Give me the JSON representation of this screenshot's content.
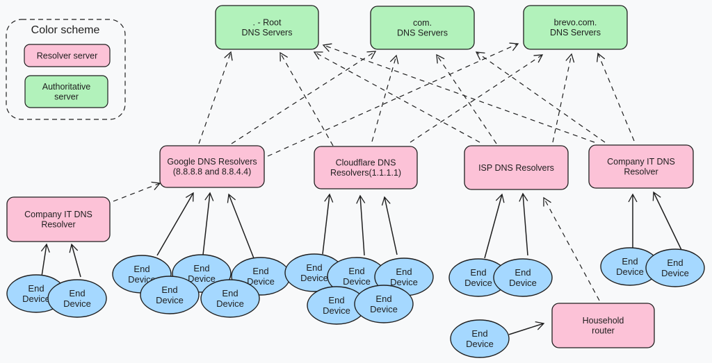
{
  "colors": {
    "background": "#f8f9fa",
    "resolver": "#fcc2d7",
    "authoritative": "#b2f2bb",
    "end_device": "#a5d8ff",
    "stroke": "#1e1e1e"
  },
  "legend": {
    "title": "Color scheme",
    "items": [
      {
        "kind": "resolver",
        "lines": [
          "Resolver server"
        ]
      },
      {
        "kind": "authoritative",
        "lines": [
          "Authoritative",
          "server"
        ]
      }
    ]
  },
  "nodes": [
    {
      "id": "root",
      "kind": "authoritative",
      "lines": [
        ". - Root",
        "DNS Servers"
      ]
    },
    {
      "id": "com",
      "kind": "authoritative",
      "lines": [
        "com.",
        "DNS Servers"
      ]
    },
    {
      "id": "brevo",
      "kind": "authoritative",
      "lines": [
        "brevo.com.",
        "DNS Servers"
      ]
    },
    {
      "id": "google",
      "kind": "resolver",
      "lines": [
        "Google DNS Resolvers",
        "(8.8.8.8 and 8.8.4.4)"
      ]
    },
    {
      "id": "cloudflare",
      "kind": "resolver",
      "lines": [
        "Cloudflare DNS",
        "Resolvers(1.1.1.1)"
      ]
    },
    {
      "id": "isp",
      "kind": "resolver",
      "lines": [
        "ISP DNS Resolvers"
      ]
    },
    {
      "id": "company-right",
      "kind": "resolver",
      "lines": [
        "Company IT DNS",
        "Resolver"
      ]
    },
    {
      "id": "company-left",
      "kind": "resolver",
      "lines": [
        "Company IT DNS",
        "Resolver"
      ]
    },
    {
      "id": "household",
      "kind": "resolver",
      "lines": [
        "Household",
        "router"
      ]
    }
  ],
  "end_device": {
    "lines": [
      "End",
      "Device"
    ]
  },
  "end_device_groups": [
    {
      "connects_to": "company-left",
      "count": 2
    },
    {
      "connects_to": "google",
      "count": 5
    },
    {
      "connects_to": "cloudflare",
      "count": 5
    },
    {
      "connects_to": "isp",
      "count": 2
    },
    {
      "connects_to": "household",
      "count": 1
    },
    {
      "connects_to": "company-right",
      "count": 2
    }
  ],
  "edges": {
    "dashed": [
      [
        "company-left",
        "google"
      ],
      [
        "household",
        "isp"
      ],
      [
        "google",
        "root"
      ],
      [
        "google",
        "com"
      ],
      [
        "google",
        "brevo"
      ],
      [
        "cloudflare",
        "root"
      ],
      [
        "cloudflare",
        "com"
      ],
      [
        "cloudflare",
        "brevo"
      ],
      [
        "isp",
        "root"
      ],
      [
        "isp",
        "com"
      ],
      [
        "isp",
        "brevo"
      ],
      [
        "company-right",
        "root"
      ],
      [
        "company-right",
        "com"
      ],
      [
        "company-right",
        "brevo"
      ]
    ]
  }
}
